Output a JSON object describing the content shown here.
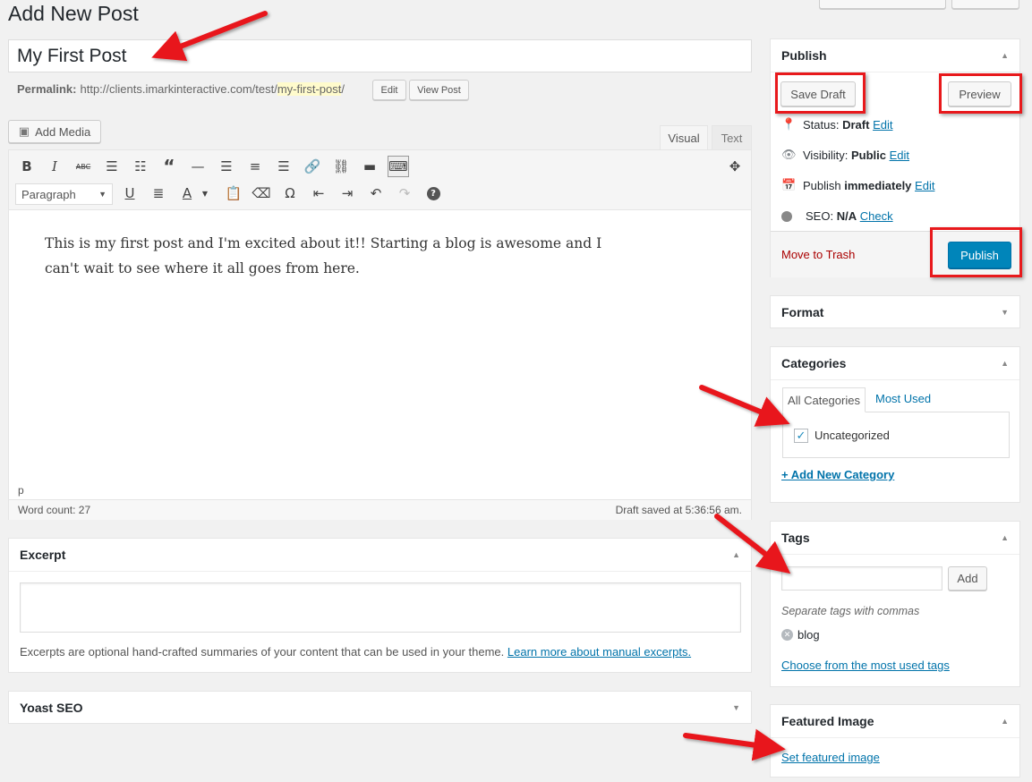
{
  "page": {
    "title": "Add New Post"
  },
  "post": {
    "title_value": "My First Post",
    "permalink_label": "Permalink:",
    "permalink_base": "http://clients.imarkinteractive.com/test/",
    "permalink_slug": "my-first-post",
    "permalink_trailing": "/",
    "edit_button": "Edit",
    "view_post_button": "View Post"
  },
  "editor": {
    "add_media": "Add Media",
    "tab_visual": "Visual",
    "tab_text": "Text",
    "format_select": "Paragraph",
    "content": "This is my first post and I'm excited about it!! Starting a blog is awesome and I can't wait to see where it all goes from here.",
    "path": "p",
    "word_count": "Word count: 27",
    "draft_saved": "Draft saved at 5:36:56 am."
  },
  "excerpt": {
    "title": "Excerpt",
    "help_text": "Excerpts are optional hand-crafted summaries of your content that can be used in your theme.",
    "help_link": "Learn more about manual excerpts."
  },
  "yoast": {
    "title": "Yoast SEO"
  },
  "publish_box": {
    "title": "Publish",
    "save_draft": "Save Draft",
    "preview": "Preview",
    "status_label": "Status:",
    "status_value": "Draft",
    "visibility_label": "Visibility:",
    "visibility_value": "Public",
    "publish_label": "Publish",
    "publish_value": "immediately",
    "seo_label": "SEO:",
    "seo_value": "N/A",
    "seo_check": "Check",
    "edit_link": "Edit",
    "move_to_trash": "Move to Trash",
    "publish_button": "Publish"
  },
  "format_box": {
    "title": "Format"
  },
  "categories_box": {
    "title": "Categories",
    "tab_all": "All Categories",
    "tab_most_used": "Most Used",
    "items": [
      {
        "label": "Uncategorized",
        "checked": true
      }
    ],
    "add_new": "+ Add New Category"
  },
  "tags_box": {
    "title": "Tags",
    "add_button": "Add",
    "hint": "Separate tags with commas",
    "tags": [
      "blog"
    ],
    "choose_link": "Choose from the most used tags"
  },
  "featured_image_box": {
    "title": "Featured Image",
    "set_link": "Set featured image"
  },
  "colors": {
    "accent": "#0073aa",
    "publish_button": "#0085ba",
    "annotation_red": "#e8191c",
    "slug_highlight": "#fffbcc",
    "trash": "#a00"
  }
}
